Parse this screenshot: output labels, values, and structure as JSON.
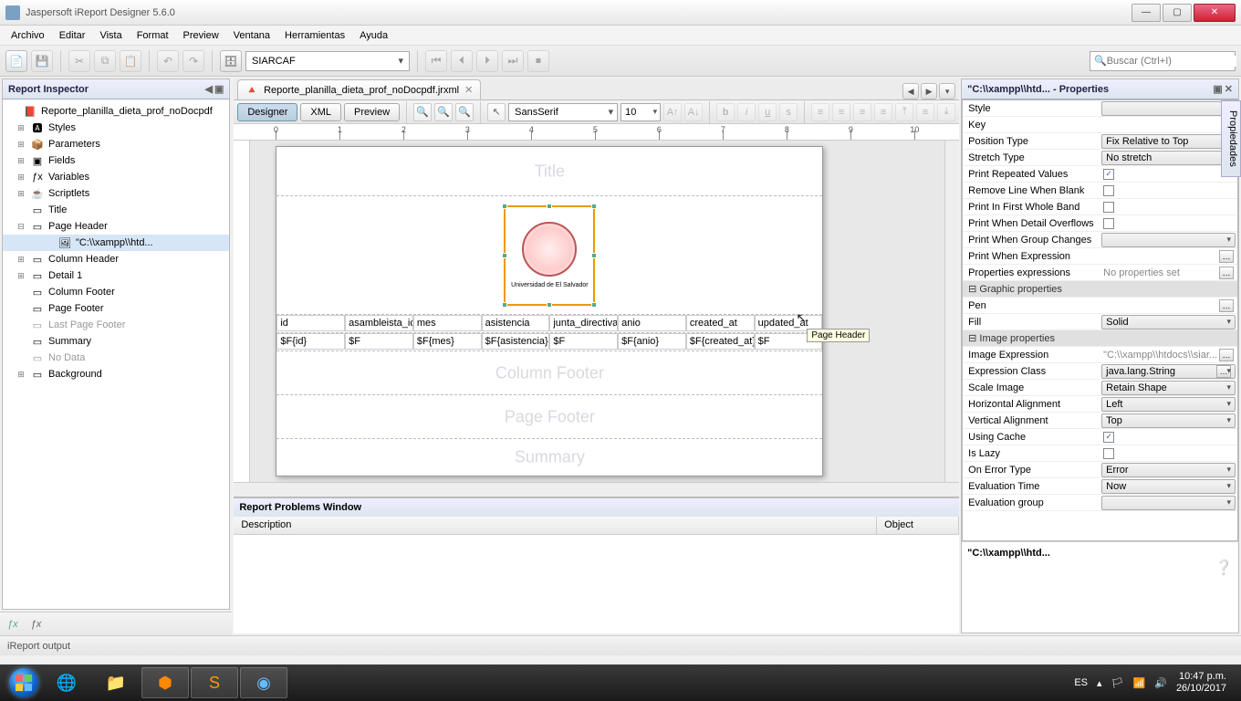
{
  "window": {
    "title": "Jaspersoft iReport Designer 5.6.0"
  },
  "menu": [
    "Archivo",
    "Editar",
    "Vista",
    "Format",
    "Preview",
    "Ventana",
    "Herramientas",
    "Ayuda"
  ],
  "toolbar": {
    "datasource": "SIARCAF",
    "search_placeholder": "Buscar (Ctrl+I)"
  },
  "inspector": {
    "title": "Report Inspector",
    "root": "Reporte_planilla_dieta_prof_noDocpdf",
    "nodes": [
      {
        "label": "Styles",
        "icon": "🅰",
        "exp": "⊞"
      },
      {
        "label": "Parameters",
        "icon": "📦",
        "exp": "⊞"
      },
      {
        "label": "Fields",
        "icon": "▣",
        "exp": "⊞"
      },
      {
        "label": "Variables",
        "icon": "ƒx",
        "exp": "⊞"
      },
      {
        "label": "Scriptlets",
        "icon": "☕",
        "exp": "⊞"
      },
      {
        "label": "Title",
        "icon": "▭",
        "exp": ""
      },
      {
        "label": "Page Header",
        "icon": "▭",
        "exp": "⊟",
        "children": [
          {
            "label": "\"C:\\\\xampp\\\\htd...",
            "icon": "🖼"
          }
        ]
      },
      {
        "label": "Column Header",
        "icon": "▭",
        "exp": "⊞"
      },
      {
        "label": "Detail 1",
        "icon": "▭",
        "exp": "⊞"
      },
      {
        "label": "Column Footer",
        "icon": "▭",
        "exp": ""
      },
      {
        "label": "Page Footer",
        "icon": "▭",
        "exp": ""
      },
      {
        "label": "Last Page Footer",
        "icon": "▭",
        "exp": "",
        "dim": true
      },
      {
        "label": "Summary",
        "icon": "▭",
        "exp": ""
      },
      {
        "label": "No Data",
        "icon": "▭",
        "exp": "",
        "dim": true
      },
      {
        "label": "Background",
        "icon": "▭",
        "exp": "⊞"
      }
    ]
  },
  "editor": {
    "tab_label": "Reporte_planilla_dieta_prof_noDocpdf.jrxml",
    "modes": {
      "designer": "Designer",
      "xml": "XML",
      "preview": "Preview"
    },
    "font": "SansSerif",
    "size": "10",
    "image_caption": "Universidad de El Salvador",
    "tooltip": "Page Header",
    "bands": {
      "title": "Title",
      "page_header": "",
      "col_header": "",
      "detail": "",
      "col_footer": "Column Footer",
      "page_footer": "Page Footer",
      "summary": "Summary"
    },
    "columns": [
      "id",
      "asambleista_id",
      "mes",
      "asistencia",
      "junta_directiva",
      "anio",
      "created_at",
      "updated_at"
    ],
    "fields": [
      "$F{id}",
      "$F",
      "$F{mes}",
      "$F{asistencia}",
      "$F",
      "$F{anio}",
      "$F{created_at}",
      "$F"
    ]
  },
  "problems": {
    "title": "Report Problems Window",
    "cols": {
      "desc": "Description",
      "obj": "Object"
    }
  },
  "properties": {
    "title": "\"C:\\\\xampp\\\\htd... - Properties",
    "rows": [
      {
        "name": "Style",
        "type": "combo",
        "val": ""
      },
      {
        "name": "Key",
        "type": "text",
        "val": ""
      },
      {
        "name": "Position Type",
        "type": "combo",
        "val": "Fix Relative to Top"
      },
      {
        "name": "Stretch Type",
        "type": "combo",
        "val": "No stretch"
      },
      {
        "name": "Print Repeated Values",
        "type": "check",
        "val": true
      },
      {
        "name": "Remove Line When Blank",
        "type": "check",
        "val": false
      },
      {
        "name": "Print In First Whole Band",
        "type": "check",
        "val": false
      },
      {
        "name": "Print When Detail Overflows",
        "type": "check",
        "val": false
      },
      {
        "name": "Print When Group Changes",
        "type": "combo",
        "val": ""
      },
      {
        "name": "Print When Expression",
        "type": "dots",
        "val": ""
      },
      {
        "name": "Properties expressions",
        "type": "dots",
        "val": "No properties set"
      },
      {
        "section": "Graphic properties"
      },
      {
        "name": "Pen",
        "type": "dots",
        "val": ""
      },
      {
        "name": "Fill",
        "type": "combo",
        "val": "Solid"
      },
      {
        "section": "Image properties"
      },
      {
        "name": "Image Expression",
        "type": "dots",
        "val": "\"C:\\\\xampp\\\\htdocs\\\\siar..."
      },
      {
        "name": "Expression Class",
        "type": "combodots",
        "val": "java.lang.String"
      },
      {
        "name": "Scale Image",
        "type": "combo",
        "val": "Retain Shape"
      },
      {
        "name": "Horizontal Alignment",
        "type": "combo",
        "val": "Left"
      },
      {
        "name": "Vertical Alignment",
        "type": "combo",
        "val": "Top"
      },
      {
        "name": "Using Cache",
        "type": "check",
        "val": true
      },
      {
        "name": "Is Lazy",
        "type": "check",
        "val": false
      },
      {
        "name": "On Error Type",
        "type": "combo",
        "val": "Error"
      },
      {
        "name": "Evaluation Time",
        "type": "combo",
        "val": "Now"
      },
      {
        "name": "Evaluation group",
        "type": "combo",
        "val": ""
      }
    ],
    "desc_title": "\"C:\\\\xampp\\\\htd..."
  },
  "side_tab": "Propiedades",
  "status": "iReport output",
  "tray": {
    "lang": "ES",
    "time": "10:47 p.m.",
    "date": "26/10/2017"
  }
}
